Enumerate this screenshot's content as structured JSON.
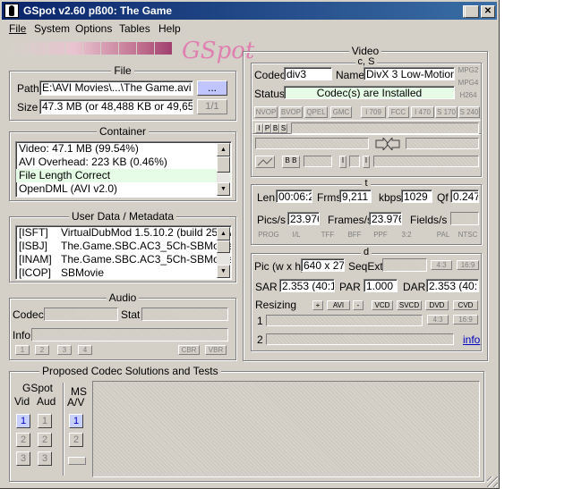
{
  "window": {
    "title": "GSpot v2.60 pß00: The Game",
    "logo": "GSpot"
  },
  "menu": [
    "File",
    "System",
    "Options",
    "Tables",
    "Help"
  ],
  "file": {
    "group": "File",
    "path_label": "Path",
    "path_value": "E:\\AVI Movies\\...\\The Game.avi",
    "browse": "...",
    "size_label": "Size",
    "size_value": "47.3 MB (or 48,488 KB or 49,651,",
    "page": "1/1"
  },
  "container": {
    "group": "Container",
    "rows": [
      "Video: 47.1 MB (99.54%)",
      "AVI Overhead: 223 KB (0.46%)",
      "File Length Correct",
      "OpenDML (AVI v2.0)"
    ]
  },
  "userdata": {
    "group": "User Data / Metadata",
    "rows": [
      {
        "key": "[ISFT]",
        "val": "VirtualDubMod 1.5.10.2 (build 2540/"
      },
      {
        "key": "[ISBJ]",
        "val": "The.Game.SBC.AC3_5Ch-SBMovie."
      },
      {
        "key": "[INAM]",
        "val": "The.Game.SBC.AC3_5Ch-SBMovie."
      },
      {
        "key": "[ICOP]",
        "val": "SBMovie"
      }
    ]
  },
  "audio": {
    "group": "Audio",
    "codec_label": "Codec",
    "stat_label": "Stat",
    "info_label": "Info",
    "nums": [
      "1",
      "2",
      "3",
      "4"
    ],
    "cbr": "CBR",
    "vbr": "VBR"
  },
  "video": {
    "group": "Video",
    "cs_label": "c, S",
    "codec_label": "Codec",
    "codec_value": "div3",
    "name_label": "Name",
    "name_value": "DivX 3 Low-Motion",
    "mpg2": "MPG2",
    "mpg4": "MPG4",
    "h264": "H264",
    "status_label": "Status",
    "status_value": "Codec(s) are Installed",
    "flags": [
      "NVOP",
      "BVOP",
      "QPEL",
      "GMC",
      "I 709",
      "FCC",
      "I 470",
      "S 170",
      "S 240"
    ],
    "ipbs": [
      "I",
      "P",
      "B",
      "S"
    ],
    "t_label": "t",
    "len_label": "Len",
    "len_value": "00:06:2",
    "frms_label": "Frms",
    "frms_value": "9,211",
    "kbps_label": "kbps",
    "kbps_value": "1029",
    "qf_label": "Qf",
    "qf_value": "0.247",
    "pics_label": "Pics/s",
    "pics_value": "23.976",
    "frames_label": "Frames/s",
    "frames_value": "23.976",
    "fields_label": "Fields/s",
    "fmt_flags": [
      "PROG",
      "I/L",
      "TFF",
      "BFF",
      "PPF",
      "3:2",
      "PAL",
      "NTSC"
    ],
    "d_label": "d",
    "pic_label": "Pic (w x h)",
    "pic_value": "640 x 27",
    "seqext_label": "SeqExt",
    "r43": "4:3",
    "r169": "16:9",
    "sar_label": "SAR",
    "sar_value": "2.353 (40:17",
    "par_label": "PAR",
    "par_value": "1.000",
    "dar_label": "DAR",
    "dar_value": "2.353 (40:1",
    "resizing_label": "Resizing",
    "plus": "+",
    "avi": "AVI",
    "minus": "-",
    "vcd": "VCD",
    "svcd": "SVCD",
    "dvd": "DVD",
    "cvd": "CVD",
    "r1": "1",
    "r2": "2",
    "info_link": "info"
  },
  "proposed": {
    "group": "Proposed Codec Solutions and Tests",
    "gspot": "GSpot",
    "vid": "Vid",
    "aud": "Aud",
    "ms": "MS",
    "av": "A/V",
    "n1": "1",
    "n2": "2",
    "n3": "3"
  }
}
